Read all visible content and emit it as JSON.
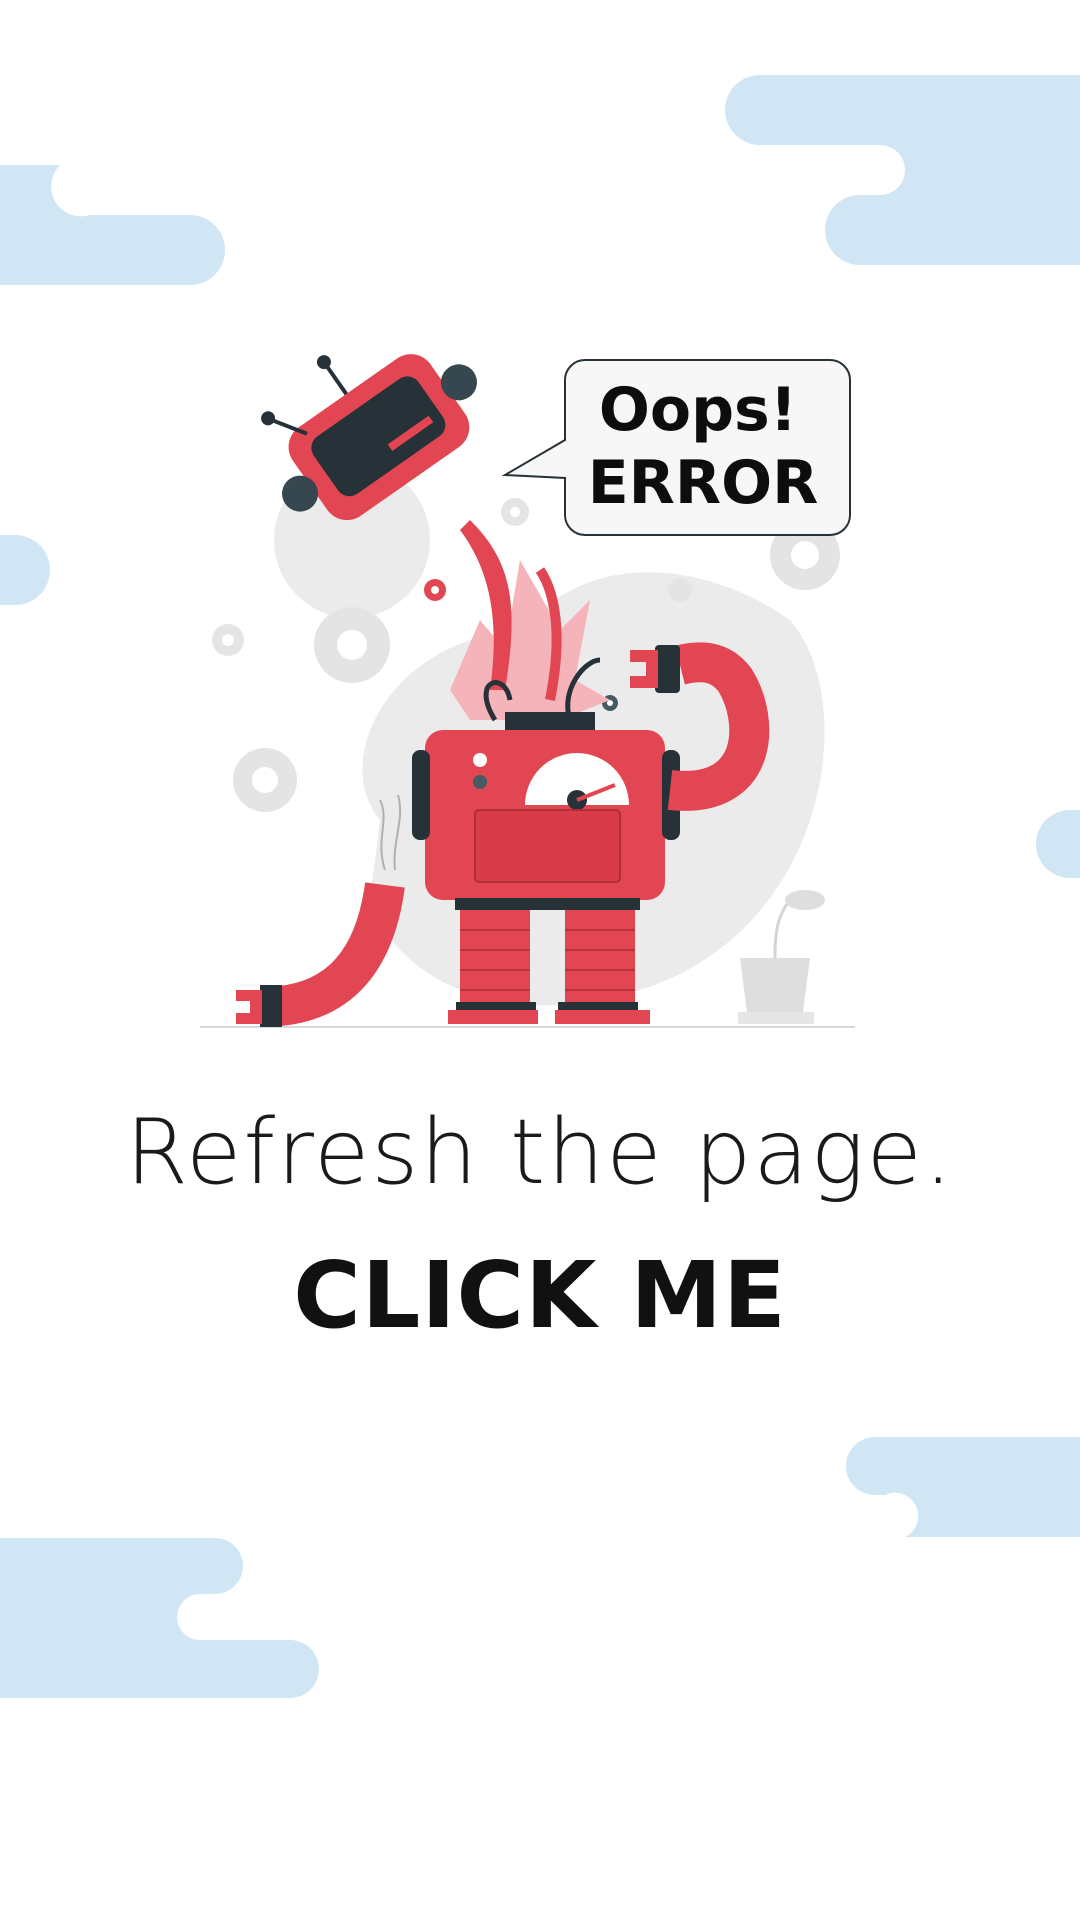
{
  "speech_bubble": {
    "line1": "Oops!",
    "line2": "ERROR"
  },
  "message": {
    "refresh": "Refresh the page.",
    "click": "CLICK ME"
  },
  "colors": {
    "cloud": "#d0e6f5",
    "robot_red": "#e14652",
    "robot_dark": "#263238",
    "backdrop_gray": "#ebebeb"
  }
}
